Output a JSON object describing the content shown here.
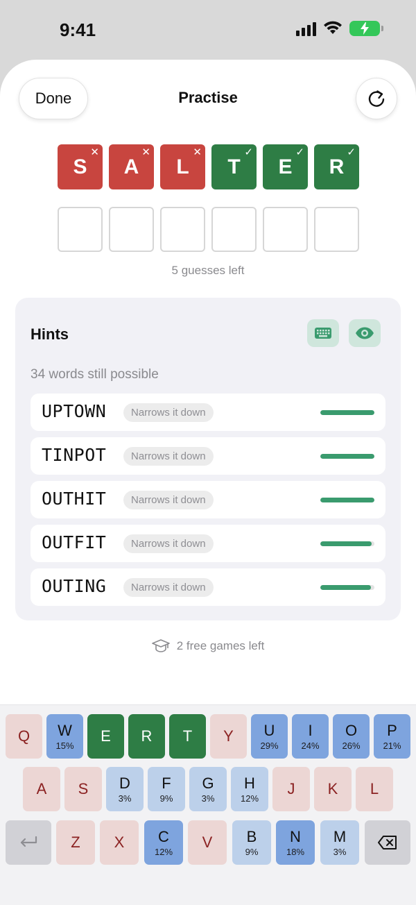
{
  "status_bar": {
    "time": "9:41"
  },
  "header": {
    "done_label": "Done",
    "title": "Practise"
  },
  "guess_row": [
    {
      "letter": "S",
      "state": "absent",
      "mark": "✕"
    },
    {
      "letter": "A",
      "state": "absent",
      "mark": "✕"
    },
    {
      "letter": "L",
      "state": "absent",
      "mark": "✕"
    },
    {
      "letter": "T",
      "state": "correct",
      "mark": "✓"
    },
    {
      "letter": "E",
      "state": "correct",
      "mark": "✓"
    },
    {
      "letter": "R",
      "state": "correct",
      "mark": "✓"
    }
  ],
  "guesses_left": "5 guesses left",
  "hints": {
    "title": "Hints",
    "possible_text": "34 words still possible",
    "words": [
      {
        "word": "UPTOWN",
        "tag": "Narrows it down",
        "strength": 1.0
      },
      {
        "word": "TINPOT",
        "tag": "Narrows it down",
        "strength": 1.0
      },
      {
        "word": "OUTHIT",
        "tag": "Narrows it down",
        "strength": 1.0
      },
      {
        "word": "OUTFIT",
        "tag": "Narrows it down",
        "strength": 0.95
      },
      {
        "word": "OUTING",
        "tag": "Narrows it down",
        "strength": 0.93
      }
    ]
  },
  "free_games": "2 free games left",
  "keyboard": {
    "row1": [
      {
        "key": "Q",
        "state": "absent",
        "pct": ""
      },
      {
        "key": "W",
        "state": "blue",
        "pct": "15%"
      },
      {
        "key": "E",
        "state": "correct",
        "pct": ""
      },
      {
        "key": "R",
        "state": "correct",
        "pct": ""
      },
      {
        "key": "T",
        "state": "correct",
        "pct": ""
      },
      {
        "key": "Y",
        "state": "absent",
        "pct": ""
      },
      {
        "key": "U",
        "state": "blue",
        "pct": "29%"
      },
      {
        "key": "I",
        "state": "blue",
        "pct": "24%"
      },
      {
        "key": "O",
        "state": "blue",
        "pct": "26%"
      },
      {
        "key": "P",
        "state": "blue",
        "pct": "21%"
      }
    ],
    "row2": [
      {
        "key": "A",
        "state": "absent",
        "pct": ""
      },
      {
        "key": "S",
        "state": "absent",
        "pct": ""
      },
      {
        "key": "D",
        "state": "blue-light",
        "pct": "3%"
      },
      {
        "key": "F",
        "state": "blue-light",
        "pct": "9%"
      },
      {
        "key": "G",
        "state": "blue-light",
        "pct": "3%"
      },
      {
        "key": "H",
        "state": "blue-light",
        "pct": "12%"
      },
      {
        "key": "J",
        "state": "absent",
        "pct": ""
      },
      {
        "key": "K",
        "state": "absent",
        "pct": ""
      },
      {
        "key": "L",
        "state": "absent",
        "pct": ""
      }
    ],
    "row3": [
      {
        "key": "Z",
        "state": "absent",
        "pct": ""
      },
      {
        "key": "X",
        "state": "absent",
        "pct": ""
      },
      {
        "key": "C",
        "state": "blue",
        "pct": "12%"
      },
      {
        "key": "V",
        "state": "absent",
        "pct": ""
      },
      {
        "key": "B",
        "state": "blue-light",
        "pct": "9%"
      },
      {
        "key": "N",
        "state": "blue",
        "pct": "18%"
      },
      {
        "key": "M",
        "state": "blue-light",
        "pct": "3%"
      }
    ],
    "enter_icon": "return-icon",
    "delete_icon": "backspace-icon"
  },
  "colors": {
    "absent_tile": "#c8453f",
    "correct_tile": "#2e7d45",
    "hint_bar": "#3a9b6e",
    "key_blue": "#7ea4de",
    "key_blue_light": "#bcd0ea",
    "key_absent": "#ecd6d4"
  }
}
